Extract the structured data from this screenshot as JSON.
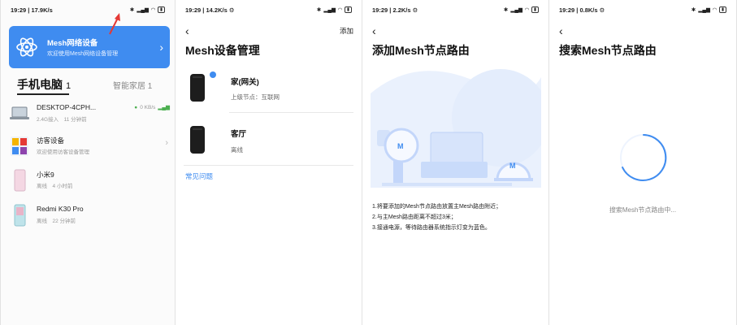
{
  "screens": [
    {
      "status": {
        "time": "19:29",
        "speed": "17.9K/s"
      },
      "mesh_card": {
        "title": "Mesh网络设备",
        "subtitle": "欢迎使用Mesh网络设备管理"
      },
      "tabs": {
        "active": "手机电脑",
        "count": "1",
        "other": "智能家居 1"
      },
      "devices": [
        {
          "name": "DESKTOP-4CPH...",
          "meta": "2.4G接入　11 分钟前",
          "speed": "0 KB/s"
        },
        {
          "name": "访客设备",
          "meta": "欢迎使用访客设备管理"
        },
        {
          "name": "小米9",
          "meta": "离线　4 小时前"
        },
        {
          "name": "Redmi K30 Pro",
          "meta": "离线　22 分钟前"
        }
      ]
    },
    {
      "status": {
        "time": "19:29",
        "speed": "14.2K/s"
      },
      "action": "添加",
      "title": "Mesh设备管理",
      "routers": [
        {
          "name": "家(网关)",
          "sub": "上级节点：互联网"
        },
        {
          "name": "客厅",
          "sub": "离线"
        }
      ],
      "faq": "常见问题"
    },
    {
      "status": {
        "time": "19:29",
        "speed": "2.2K/s"
      },
      "title": "添加Mesh节点路由",
      "instructions": [
        "1.将要添加的Mesh节点路由放置主Mesh路由附近；",
        "2.与主Mesh路由距离不超过3米；",
        "3.接通电源，等待路由器系统指示灯变为蓝色。"
      ]
    },
    {
      "status": {
        "time": "19:29",
        "speed": "0.8K/s"
      },
      "title": "搜索Mesh节点路由",
      "searching": "搜索Mesh节点路由中..."
    }
  ],
  "icons": {
    "back": "back-arrow-icon",
    "chevron": "chevron-right-icon",
    "mesh": "mesh-network-icon",
    "annotation": "red-arrow-icon"
  },
  "colors": {
    "accent": "#3f8cf0",
    "annotation": "#e53935"
  }
}
